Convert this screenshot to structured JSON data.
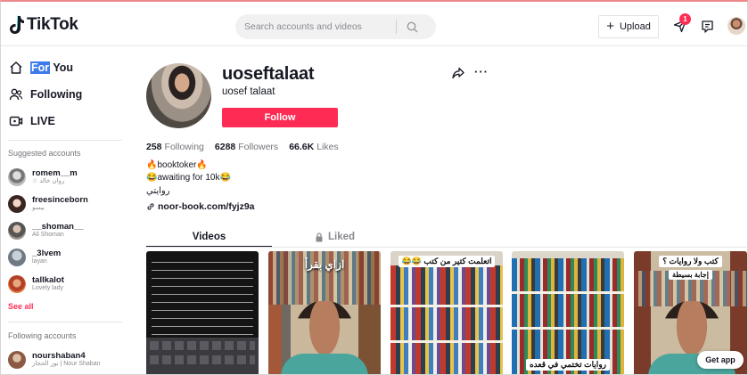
{
  "header": {
    "logo_text": "TikTok",
    "search_placeholder": "Search accounts and videos",
    "upload_label": "Upload",
    "inbox_badge": "1"
  },
  "sidebar": {
    "nav": [
      {
        "label_highlight": "For",
        "label_rest": " You",
        "icon": "home-icon"
      },
      {
        "label": "Following",
        "icon": "following-icon"
      },
      {
        "label": "LIVE",
        "icon": "live-icon"
      }
    ],
    "suggested_title": "Suggested accounts",
    "suggested": [
      {
        "name": "romem__m",
        "sub": "☆ روان خالد"
      },
      {
        "name": "freesinceborn",
        "sub": "بيسو"
      },
      {
        "name": "__shoman__",
        "sub": "Ali Shoman"
      },
      {
        "name": "_3lvem",
        "sub": "layan"
      },
      {
        "name": "tallkalot",
        "sub": "Lovely lady"
      }
    ],
    "see_all": "See all",
    "following_title": "Following accounts",
    "following": [
      {
        "name": "nourshaban4",
        "sub": "نور الحجاز | Nour Shaban"
      }
    ]
  },
  "profile": {
    "username": "uoseftalaat",
    "nickname": "uosef talaat",
    "follow_label": "Follow",
    "stats": {
      "following_count": "258",
      "following_label": "Following",
      "followers_count": "6288",
      "followers_label": "Followers",
      "likes_count": "66.6K",
      "likes_label": "Likes"
    },
    "bio": [
      "🔥booktoker🔥",
      "😂awaiting for 10k😂",
      "روايتي"
    ],
    "link": "noor-book.com/fyjz9a"
  },
  "tabs": {
    "videos": "Videos",
    "liked": "Liked"
  },
  "videos": [
    {
      "caption": ""
    },
    {
      "caption": "ازاي بقرأ"
    },
    {
      "caption": "اتعلمت كتير من كتب 😂😂"
    },
    {
      "caption": "روايات تختمي في قعده"
    },
    {
      "caption": "كتب ولا روايات ؟",
      "caption2": "إجابة بسيطة"
    }
  ],
  "get_app": "Get app",
  "colors": {
    "brand": "#fe2c55",
    "text": "#161823",
    "muted": "#73757a"
  }
}
